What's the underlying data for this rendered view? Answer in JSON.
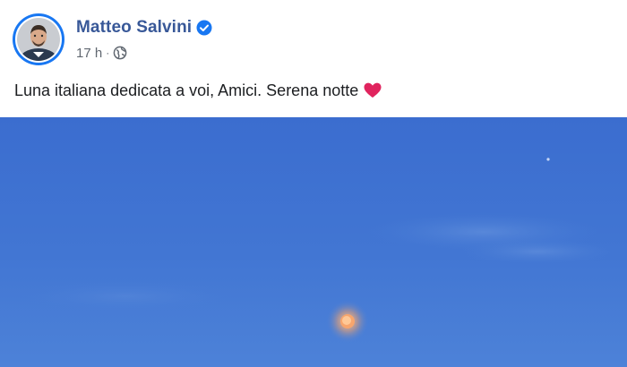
{
  "post": {
    "author": "Matteo Salvini",
    "timestamp": "17 h",
    "separator": "·",
    "privacy_icon": "globe-icon",
    "verified_icon": "verified-badge-icon",
    "caption": "Luna italiana dedicata a voi, Amici. Serena notte",
    "caption_emoji": "heart-icon"
  },
  "colors": {
    "author_name": "#385898",
    "verified_badge": "#1877f2",
    "meta_text": "#606770",
    "caption_text": "#1c1e21",
    "heart": "#e0245e",
    "sky_top": "#3c6fd0",
    "sky_bottom": "#4a7fd6",
    "moon": "#f6a16a"
  }
}
